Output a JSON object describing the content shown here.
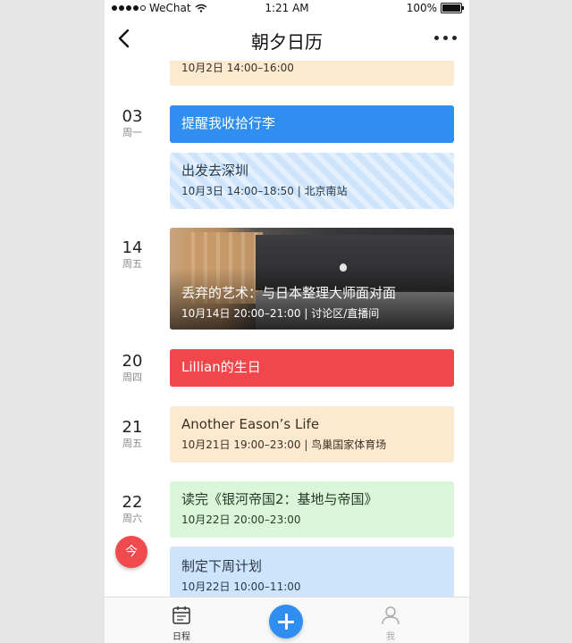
{
  "status": {
    "carrier": "WeChat",
    "time": "1:21 AM",
    "battery": "100%"
  },
  "nav": {
    "title": "朝夕日历"
  },
  "events": {
    "oct2_partial": {
      "subtitle": "10月2日 14:00–16:00"
    },
    "d03": {
      "day": "03",
      "weekday": "周一"
    },
    "remind": {
      "title": "提醒我收拾行李"
    },
    "shenzhen": {
      "title": "出发去深圳",
      "subtitle": "10月3日 14:00–18:50 | 北京南站"
    },
    "d14": {
      "day": "14",
      "weekday": "周五"
    },
    "art": {
      "title": "丢弃的艺术：与日本整理大师面对面",
      "subtitle": "10月14日 20:00–21:00 | 讨论区/直播间"
    },
    "d20": {
      "day": "20",
      "weekday": "周四"
    },
    "lillian": {
      "title": "Lillian的生日"
    },
    "d21": {
      "day": "21",
      "weekday": "周五"
    },
    "eason": {
      "title": "Another Eason’s Life",
      "subtitle": "10月21日 19:00–23:00 | 鸟巢国家体育场"
    },
    "d22": {
      "day": "22",
      "weekday": "周六"
    },
    "book": {
      "title": "读完《银河帝国2：基地与帝国》",
      "subtitle": "10月22日 20:00–23:00"
    },
    "plan": {
      "title": "制定下周计划",
      "subtitle": "10月22日 10:00–11:00"
    }
  },
  "today_button": "今",
  "tabbar": {
    "schedule": "日程",
    "me": "我"
  },
  "colors": {
    "accent_blue": "#2f8ef0",
    "red": "#f0464c",
    "peach": "#fde9cf",
    "light_blue": "#cde4fb",
    "light_green": "#d9f6d9"
  }
}
